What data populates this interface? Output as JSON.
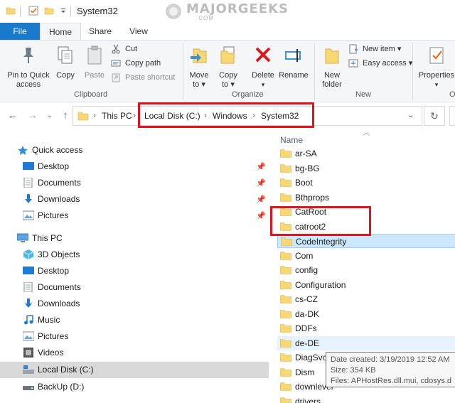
{
  "window": {
    "title": "System32"
  },
  "watermark": {
    "brand": "MAJORGEEKS",
    "suffix": ".COM"
  },
  "tabs": [
    {
      "label": "File"
    },
    {
      "label": "Home"
    },
    {
      "label": "Share"
    },
    {
      "label": "View"
    }
  ],
  "clipboard": {
    "pin": "Pin to Quick access",
    "copy": "Copy",
    "paste": "Paste",
    "cut": "Cut",
    "copy_path": "Copy path",
    "paste_shortcut": "Paste shortcut",
    "group": "Clipboard"
  },
  "organize": {
    "move_to": "Move to",
    "copy_to": "Copy to",
    "delete": "Delete",
    "rename": "Rename",
    "group": "Organize"
  },
  "new_group": {
    "new_folder": "New folder",
    "new_item": "New item",
    "easy_access": "Easy access",
    "group": "New"
  },
  "open_group": {
    "properties": "Properties",
    "group_fragment": "O"
  },
  "address": {
    "crumbs": [
      "This PC",
      "Local Disk (C:)",
      "Windows",
      "System32"
    ]
  },
  "nav": {
    "quick_access": "Quick access",
    "quick_items": [
      "Desktop",
      "Documents",
      "Downloads",
      "Pictures"
    ],
    "this_pc": "This PC",
    "pc_items": [
      "3D Objects",
      "Desktop",
      "Documents",
      "Downloads",
      "Music",
      "Pictures",
      "Videos",
      "Local Disk (C:)",
      "BackUp (D:)"
    ]
  },
  "filelist": {
    "column": "Name",
    "items": [
      "ar-SA",
      "bg-BG",
      "Boot",
      "Bthprops",
      "CatRoot",
      "catroot2",
      "CodeIntegrity",
      "Com",
      "config",
      "Configuration",
      "cs-CZ",
      "da-DK",
      "DDFs",
      "de-DE",
      "DiagSvcs",
      "Dism",
      "downlevel",
      "drivers"
    ]
  },
  "tooltip": {
    "line1": "Date created: 3/19/2019 12:52 AM",
    "line2": "Size: 354 KB",
    "line3": "Files: APHostRes.dll.mui, cdosys.d"
  },
  "colors": {
    "accent": "#1979ca",
    "highlight": "#e0141e",
    "folder": "#f8d775",
    "selection": "#cce8ff"
  }
}
